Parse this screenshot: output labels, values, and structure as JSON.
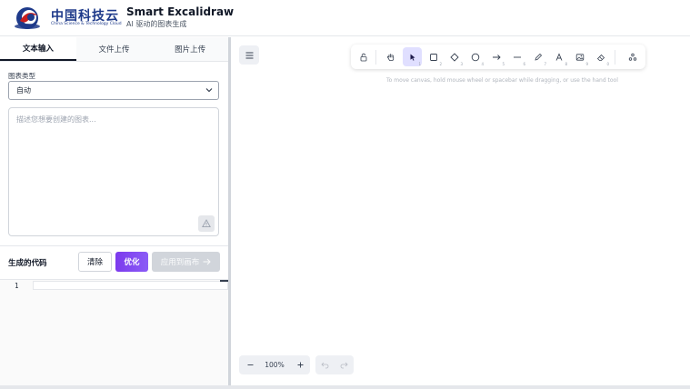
{
  "header": {
    "logo_cn": "中国科技云",
    "logo_en": "China Science & Technology Cloud",
    "title": "Smart Excalidraw",
    "subtitle": "AI 驱动的图表生成"
  },
  "tabs": [
    {
      "label": "文本输入",
      "active": true
    },
    {
      "label": "文件上传",
      "active": false
    },
    {
      "label": "图片上传",
      "active": false
    }
  ],
  "form": {
    "chart_type_label": "图表类型",
    "chart_type_value": "自动",
    "textarea_placeholder": "描述您想要创建的图表..."
  },
  "code": {
    "title": "生成的代码",
    "clear_label": "清除",
    "optimize_label": "优化",
    "apply_label": "应用到画布",
    "line_numbers": [
      "1"
    ]
  },
  "canvas": {
    "hint": "To move canvas, hold mouse wheel or spacebar while dragging, or use the hand tool",
    "zoom": "100%",
    "tools": [
      {
        "name": "lock-icon",
        "key": ""
      },
      {
        "name": "hand-icon",
        "key": ""
      },
      {
        "name": "selection-icon",
        "key": "1",
        "active": true
      },
      {
        "name": "rectangle-icon",
        "key": "2"
      },
      {
        "name": "diamond-icon",
        "key": "3"
      },
      {
        "name": "ellipse-icon",
        "key": "4"
      },
      {
        "name": "arrow-icon",
        "key": "5"
      },
      {
        "name": "line-icon",
        "key": "6"
      },
      {
        "name": "pencil-icon",
        "key": "7"
      },
      {
        "name": "text-icon",
        "key": "8"
      },
      {
        "name": "image-icon",
        "key": "9"
      },
      {
        "name": "eraser-icon",
        "key": "0"
      },
      {
        "name": "extra-tools-icon",
        "key": ""
      }
    ]
  },
  "colors": {
    "accent_purple": "#7c3aed",
    "brand_blue": "#1e3a8a",
    "active_tool_bg": "#e0dfff"
  }
}
